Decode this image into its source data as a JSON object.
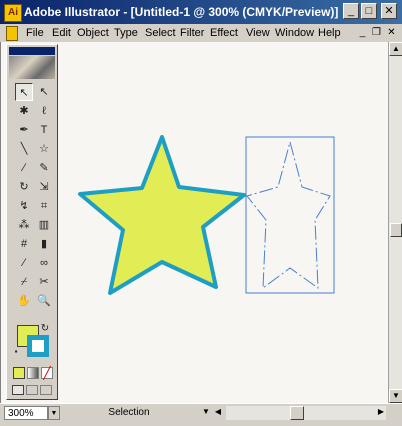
{
  "window": {
    "title": "Adobe Illustrator - [Untitled-1 @ 300% (CMYK/Preview)]",
    "app_icon": "illustrator-icon",
    "controls": {
      "minimize": "_",
      "maximize": "□",
      "close": "✕"
    }
  },
  "menubar": {
    "items": [
      {
        "label": "File"
      },
      {
        "label": "Edit"
      },
      {
        "label": "Object"
      },
      {
        "label": "Type"
      },
      {
        "label": "Select"
      },
      {
        "label": "Filter"
      },
      {
        "label": "Effect"
      },
      {
        "label": "View"
      },
      {
        "label": "Window"
      },
      {
        "label": "Help"
      }
    ],
    "doc_controls": {
      "minimize": "_",
      "restore": "❐",
      "close": "✕"
    }
  },
  "toolbox": {
    "tools": [
      {
        "name": "selection-tool",
        "glyph": "↖",
        "active": true
      },
      {
        "name": "direct-selection-tool",
        "glyph": "↖"
      },
      {
        "name": "magic-wand-tool",
        "glyph": "✱"
      },
      {
        "name": "lasso-tool",
        "glyph": "ℓ"
      },
      {
        "name": "pen-tool",
        "glyph": "✒"
      },
      {
        "name": "type-tool",
        "glyph": "T"
      },
      {
        "name": "line-tool",
        "glyph": "╲"
      },
      {
        "name": "star-tool",
        "glyph": "☆"
      },
      {
        "name": "paintbrush-tool",
        "glyph": "∕"
      },
      {
        "name": "pencil-tool",
        "glyph": "✎"
      },
      {
        "name": "rotate-tool",
        "glyph": "↻"
      },
      {
        "name": "scale-tool",
        "glyph": "⇲"
      },
      {
        "name": "warp-tool",
        "glyph": "↯"
      },
      {
        "name": "free-transform-tool",
        "glyph": "⌗"
      },
      {
        "name": "symbol-sprayer-tool",
        "glyph": "⁂"
      },
      {
        "name": "graph-tool",
        "glyph": "▥"
      },
      {
        "name": "mesh-tool",
        "glyph": "#"
      },
      {
        "name": "gradient-tool",
        "glyph": "▮"
      },
      {
        "name": "eyedropper-tool",
        "glyph": "⁄"
      },
      {
        "name": "blend-tool",
        "glyph": "∞"
      },
      {
        "name": "slice-tool",
        "glyph": "⌿"
      },
      {
        "name": "scissors-tool",
        "glyph": "✂"
      },
      {
        "name": "hand-tool",
        "glyph": "✋"
      },
      {
        "name": "zoom-tool",
        "glyph": "🔍"
      }
    ],
    "fill_color": "#e2ec55",
    "stroke_color": "#1e9ec3",
    "mode_buttons": [
      "normal-screen-mode",
      "color-mode",
      "gradient-mode",
      "none-mode"
    ],
    "screen_modes": [
      "screen-mode-1",
      "screen-mode-2",
      "screen-mode-3"
    ]
  },
  "canvas": {
    "filled_star": {
      "fill": "#e2ec55",
      "stroke": "#1e9ec3"
    },
    "outline_star": {
      "stroke": "#4a7fd0"
    }
  },
  "statusbar": {
    "zoom": "300%",
    "status": "Selection"
  }
}
